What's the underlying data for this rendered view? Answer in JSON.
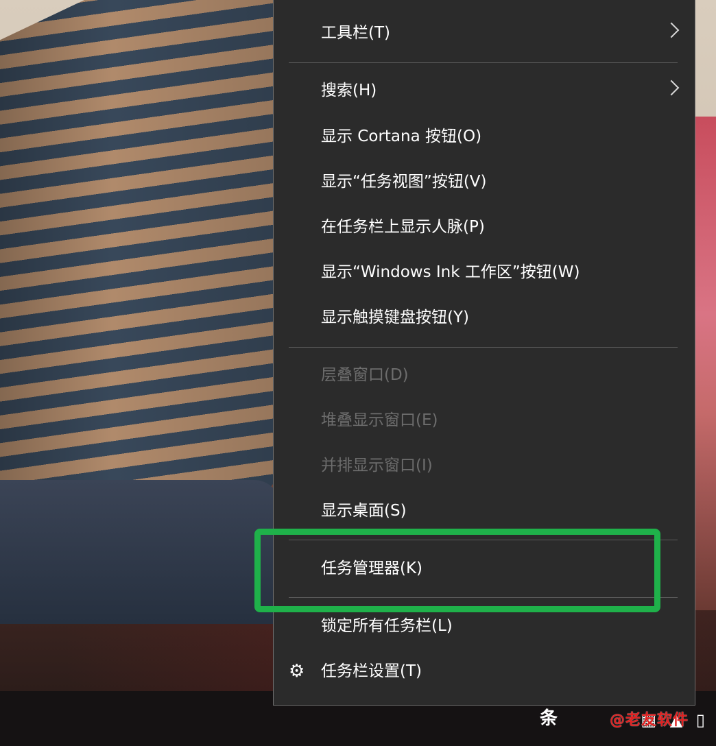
{
  "menu": {
    "items": [
      {
        "label": "工具栏(T)",
        "has_submenu": true,
        "enabled": true
      },
      {
        "label": "搜索(H)",
        "has_submenu": true,
        "enabled": true
      },
      {
        "label": "显示 Cortana 按钮(O)",
        "enabled": true
      },
      {
        "label": "显示“任务视图”按钮(V)",
        "enabled": true
      },
      {
        "label": "在任务栏上显示人脉(P)",
        "enabled": true
      },
      {
        "label": "显示“Windows Ink 工作区”按钮(W)",
        "enabled": true
      },
      {
        "label": "显示触摸键盘按钮(Y)",
        "enabled": true
      },
      {
        "label": "层叠窗口(D)",
        "enabled": false
      },
      {
        "label": "堆叠显示窗口(E)",
        "enabled": false
      },
      {
        "label": "并排显示窗口(I)",
        "enabled": false
      },
      {
        "label": "显示桌面(S)",
        "enabled": true
      },
      {
        "label": "任务管理器(K)",
        "enabled": true,
        "highlighted": true
      },
      {
        "label": "锁定所有任务栏(L)",
        "enabled": true
      },
      {
        "label": "任务栏设置(T)",
        "enabled": true,
        "icon": "gear-icon"
      }
    ]
  },
  "taskbar": {
    "tray_text": "头条",
    "watermark": "@老友软件"
  },
  "colors": {
    "menu_bg": "#2b2b2b",
    "menu_text": "#ffffff",
    "disabled_text": "#6d6d6d",
    "highlight_border": "#1fb14a"
  }
}
